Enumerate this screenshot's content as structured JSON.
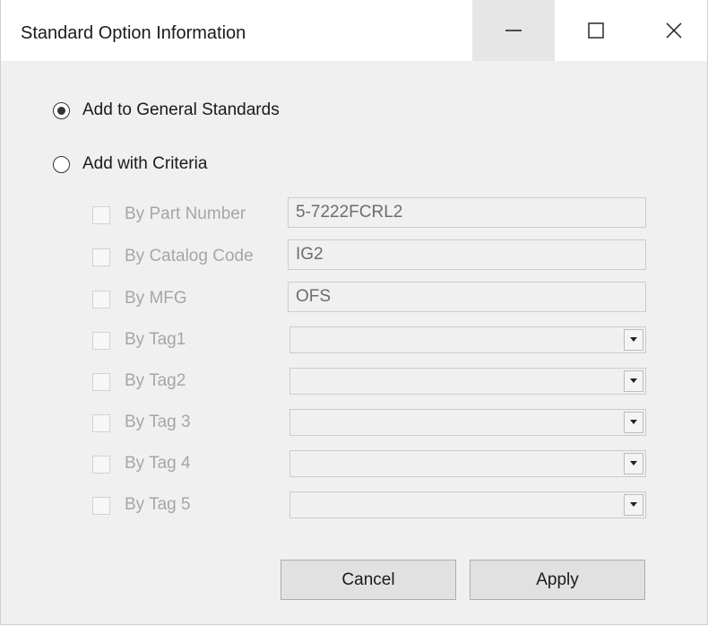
{
  "window": {
    "title": "Standard Option Information",
    "minimize_icon": "minimize-icon",
    "maximize_icon": "maximize-icon",
    "close_icon": "close-icon"
  },
  "options": {
    "general": {
      "label": "Add to General Standards",
      "selected": true
    },
    "criteria": {
      "label": "Add with Criteria",
      "selected": false
    }
  },
  "criteria": {
    "part_number": {
      "label": "By Part Number",
      "value": "5-7222FCRL2",
      "checked": false,
      "enabled": false
    },
    "catalog_code": {
      "label": "By Catalog Code",
      "value": "IG2",
      "checked": false,
      "enabled": false
    },
    "mfg": {
      "label": "By MFG",
      "value": "OFS",
      "checked": false,
      "enabled": false
    },
    "tag1": {
      "label": "By Tag1",
      "value": "",
      "checked": false,
      "enabled": false
    },
    "tag2": {
      "label": "By Tag2",
      "value": "",
      "checked": false,
      "enabled": false
    },
    "tag3": {
      "label": "By Tag 3",
      "value": "",
      "checked": false,
      "enabled": false
    },
    "tag4": {
      "label": "By Tag 4",
      "value": "",
      "checked": false,
      "enabled": false
    },
    "tag5": {
      "label": "By Tag 5",
      "value": "",
      "checked": false,
      "enabled": false
    }
  },
  "buttons": {
    "cancel": "Cancel",
    "apply": "Apply"
  },
  "colors": {
    "window_bg": "#f0f0f0",
    "titlebar_bg": "#ffffff",
    "disabled_text": "#a6a6a6",
    "button_bg": "#e1e1e1"
  }
}
